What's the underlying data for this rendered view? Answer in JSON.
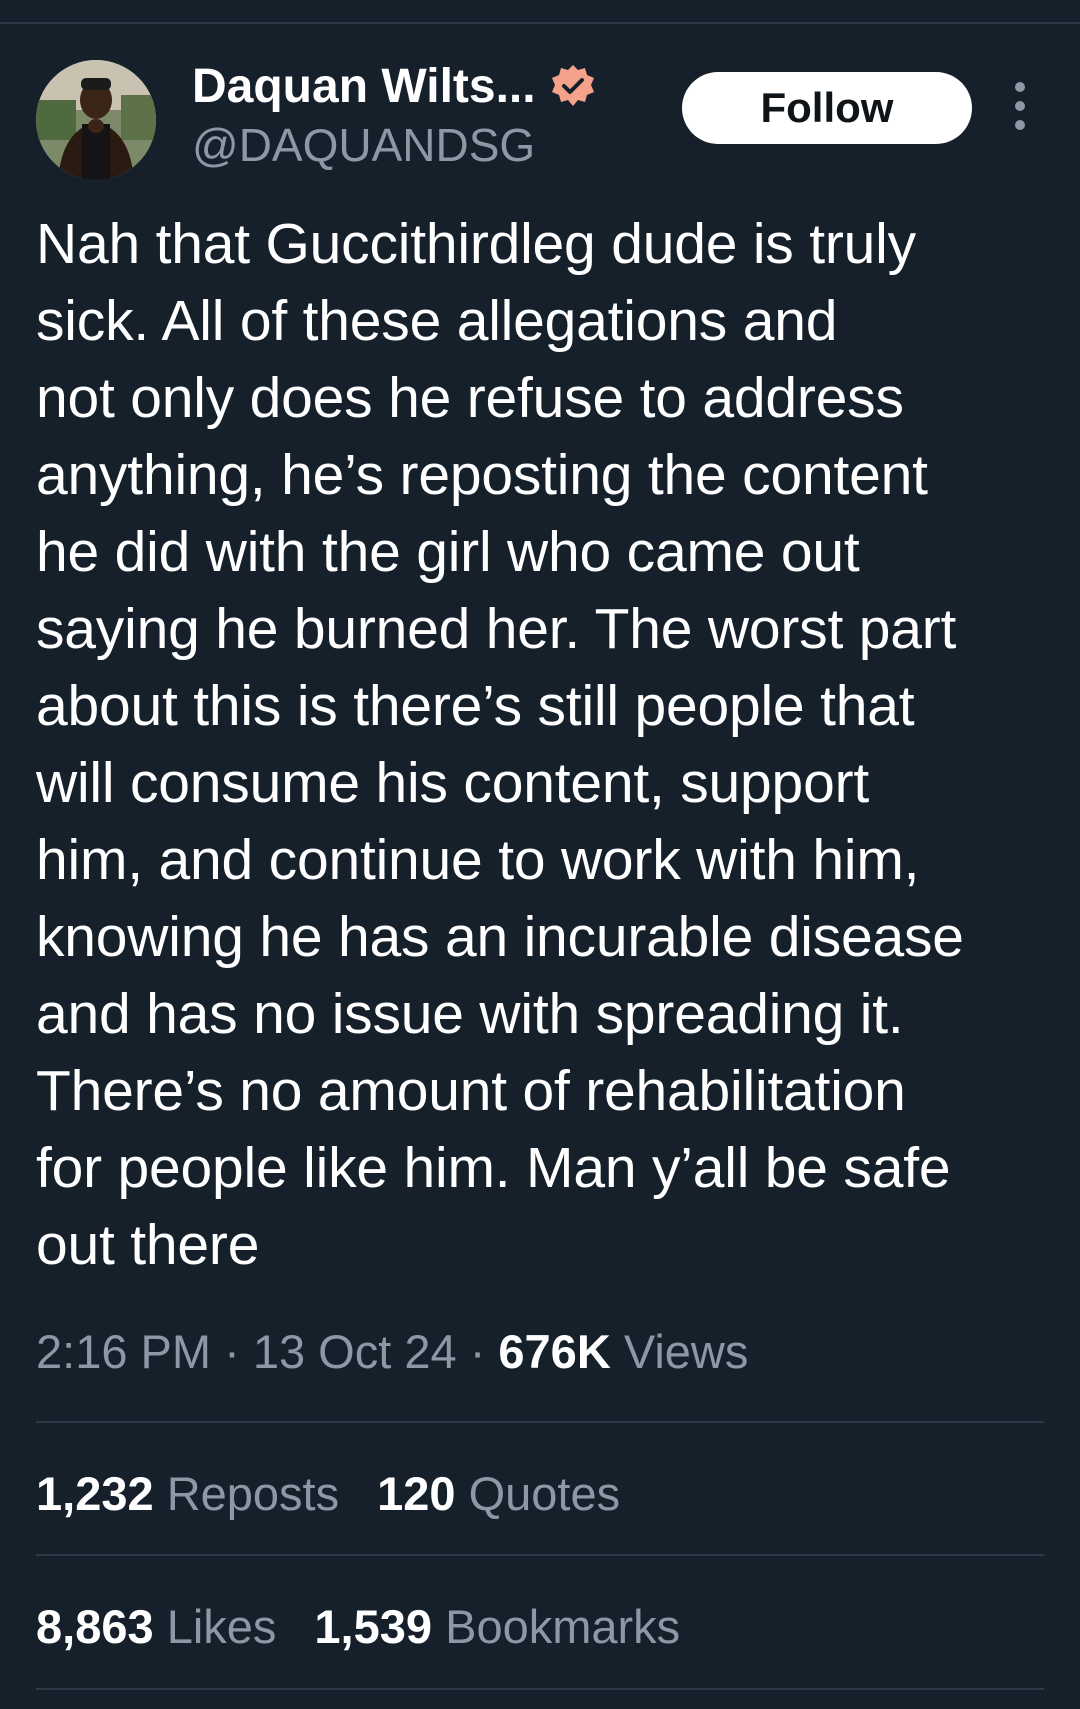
{
  "author": {
    "display_name": "Daquan Wilts...",
    "handle": "@DAQUANDSG",
    "verified_icon": "verified-badge-icon"
  },
  "follow_button": {
    "label": "Follow"
  },
  "more_menu": {
    "icon": "more-vertical-icon"
  },
  "tweet": {
    "lines": [
      "Nah that Guccithirdleg dude is truly",
      "sick. All of these allegations and",
      "not only does he refuse to address",
      "anything, he’s reposting the content",
      "he did with the girl who came out",
      "saying he burned her. The worst part",
      "about this is there’s still people that",
      "will consume his content, support",
      "him, and continue to work with him,",
      "knowing he has an incurable disease",
      "and has no issue with spreading it.",
      "There’s no amount of rehabilitation",
      "for people like him. Man y’all be safe",
      "out there"
    ]
  },
  "meta": {
    "time": "2:16 PM",
    "separator": "·",
    "date": "13 Oct 24",
    "views_count": "676K",
    "views_label": "Views"
  },
  "stats": {
    "reposts_count": "1,232",
    "reposts_label": "Reposts",
    "quotes_count": "120",
    "quotes_label": "Quotes",
    "likes_count": "8,863",
    "likes_label": "Likes",
    "bookmarks_count": "1,539",
    "bookmarks_label": "Bookmarks"
  },
  "colors": {
    "background": "#15202b",
    "text_primary": "#ffffff",
    "text_secondary": "#8b98a5",
    "divider": "#2c3a47",
    "verified_badge": "#f4a28c"
  }
}
